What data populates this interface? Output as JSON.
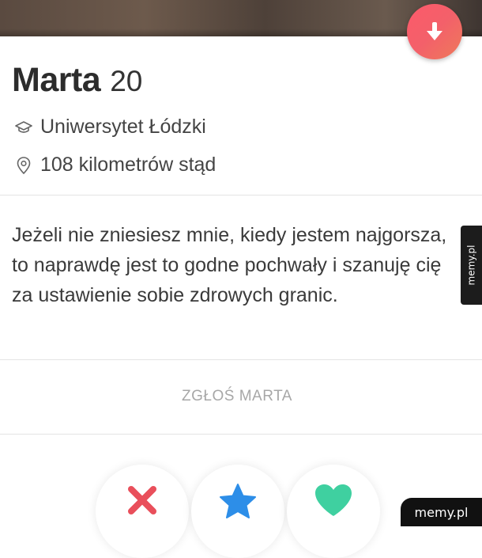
{
  "profile": {
    "name": "Marta",
    "age": "20",
    "school": "Uniwersytet Łódzki",
    "distance": "108 kilometrów stąd",
    "bio": "Jeżeli nie zniesiesz mnie, kiedy jestem najgorsza, to naprawdę jest to godne pochwały i szanuję cię za ustawienie sobie zdrowych granic."
  },
  "actions": {
    "report_label": "ZGŁOŚ MARTA",
    "buttons": [
      {
        "name": "nope",
        "icon": "x-icon",
        "color": "#e94f5b"
      },
      {
        "name": "super-like",
        "icon": "star-icon",
        "color": "#2d8ee8"
      },
      {
        "name": "like",
        "icon": "heart-icon",
        "color": "#3fd0a0"
      }
    ]
  },
  "colors": {
    "accent": "#f3606a",
    "text": "#2c2c2c",
    "muted": "#a7a7a7"
  },
  "watermark": {
    "side": "memy.pl",
    "corner": "memy.pl"
  }
}
